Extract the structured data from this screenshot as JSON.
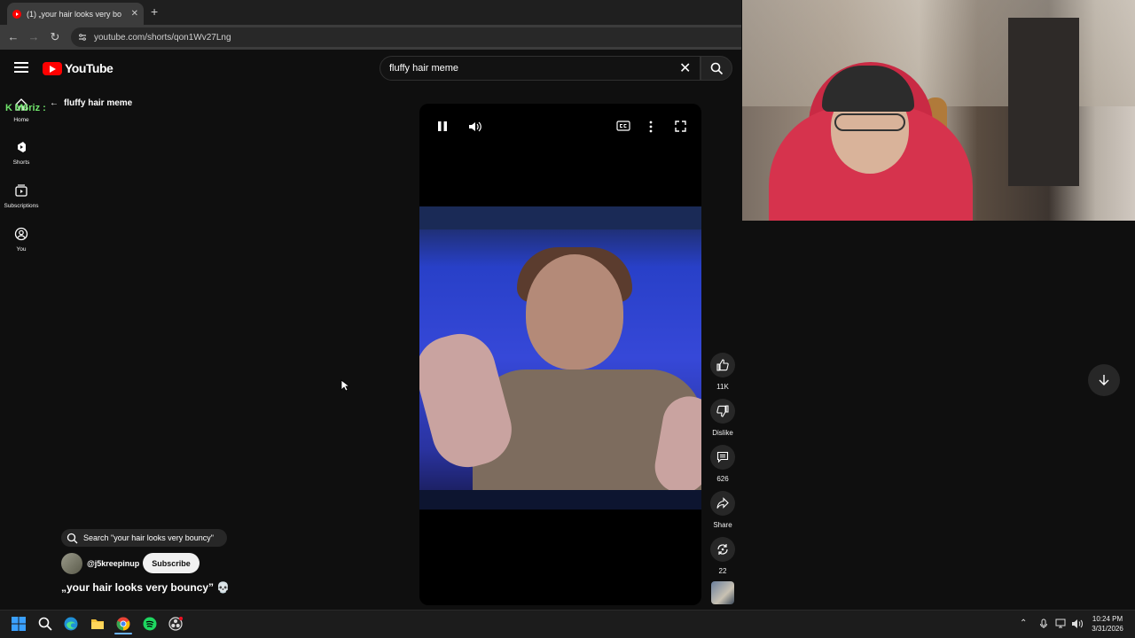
{
  "browser": {
    "tab_title": "(1) „your hair looks very bo",
    "new_tab": "+",
    "url": "youtube.com/shorts/qon1Wv27Lng"
  },
  "header": {
    "logo_text": "YouTube",
    "search_value": "fluffy hair meme"
  },
  "overlay": {
    "tag": "K M6riz :"
  },
  "left_rail": {
    "items": [
      {
        "label": "Home",
        "icon": "home-icon"
      },
      {
        "label": "Shorts",
        "icon": "shorts-icon"
      },
      {
        "label": "Subscriptions",
        "icon": "subscriptions-icon"
      },
      {
        "label": "You",
        "icon": "you-icon"
      }
    ]
  },
  "back_query": "fluffy hair meme",
  "actions": {
    "like_count": "11K",
    "dislike_label": "Dislike",
    "comment_count": "626",
    "share_label": "Share",
    "remix_count": "22"
  },
  "short": {
    "search_suggestion": "Search \"your hair looks very bouncy\"",
    "channel": "@j5kreepinup",
    "subscribe_label": "Subscribe",
    "title": "„your hair looks very bouncy” 💀"
  },
  "taskbar": {
    "time": "10:24 PM",
    "date": "3/31/2026"
  },
  "colors": {
    "brand_red": "#ff0000",
    "background": "#0f0f0f",
    "spotify_green": "#1ed760"
  }
}
